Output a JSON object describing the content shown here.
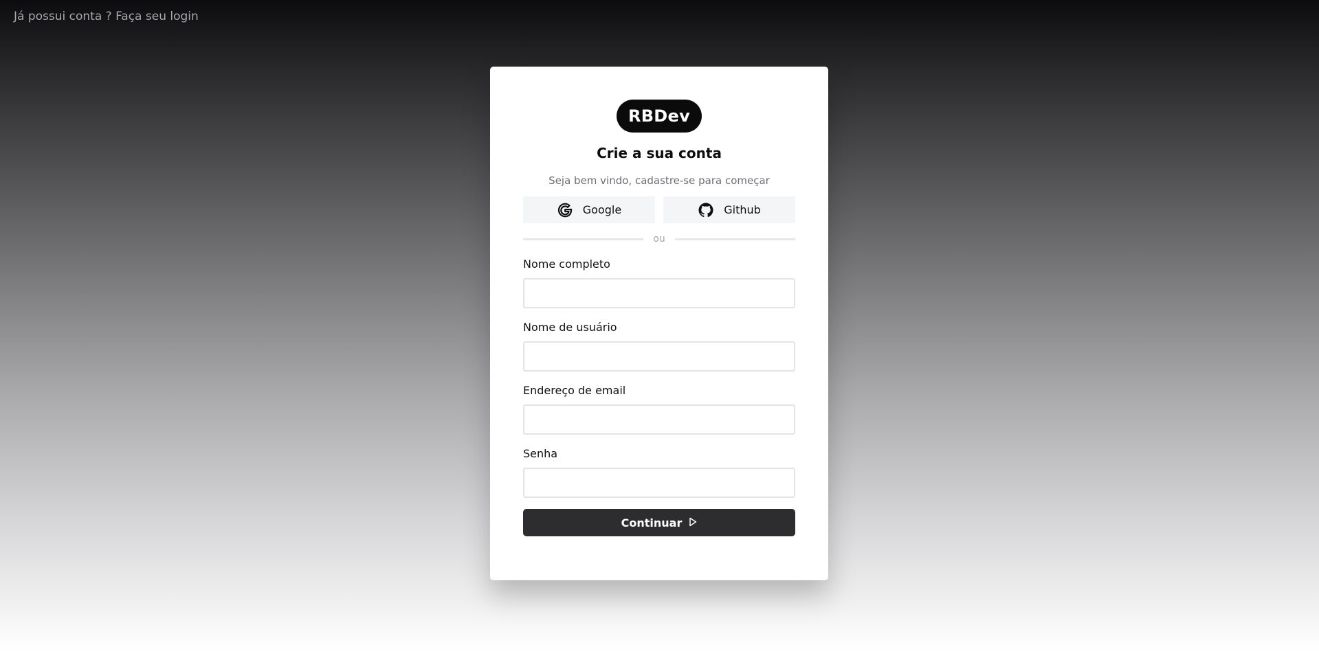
{
  "header": {
    "login_link": "Já possui conta ? Faça seu login"
  },
  "card": {
    "logo": "RBDev",
    "title": "Crie a sua conta",
    "subtitle": "Seja bem vindo, cadastre-se para começar",
    "social": {
      "google": {
        "label": "Google",
        "icon": "google-icon"
      },
      "github": {
        "label": "Github",
        "icon": "github-icon"
      }
    },
    "divider_text": "ou",
    "fields": [
      {
        "label": "Nome completo",
        "value": "",
        "placeholder": ""
      },
      {
        "label": "Nome de usuário",
        "value": "",
        "placeholder": ""
      },
      {
        "label": "Endereço de email",
        "value": "",
        "placeholder": ""
      },
      {
        "label": "Senha",
        "value": "",
        "placeholder": ""
      }
    ],
    "submit": {
      "label": "Continuar",
      "icon": "play-outline-icon"
    }
  },
  "colors": {
    "logo_bg": "#0b0b0b",
    "submit_bg": "#2d2d2f",
    "social_bg": "#f4f5f7",
    "muted_text": "#6b6e75"
  }
}
